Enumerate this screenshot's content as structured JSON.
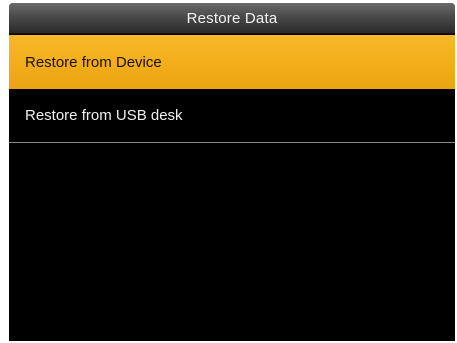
{
  "header": {
    "title": "Restore Data"
  },
  "menu": {
    "items": [
      {
        "label": "Restore from Device",
        "selected": true
      },
      {
        "label": "Restore from USB desk",
        "selected": false
      }
    ]
  },
  "colors": {
    "background": "#000000",
    "highlight": "#f2ac18",
    "text": "#f0f0f0"
  }
}
